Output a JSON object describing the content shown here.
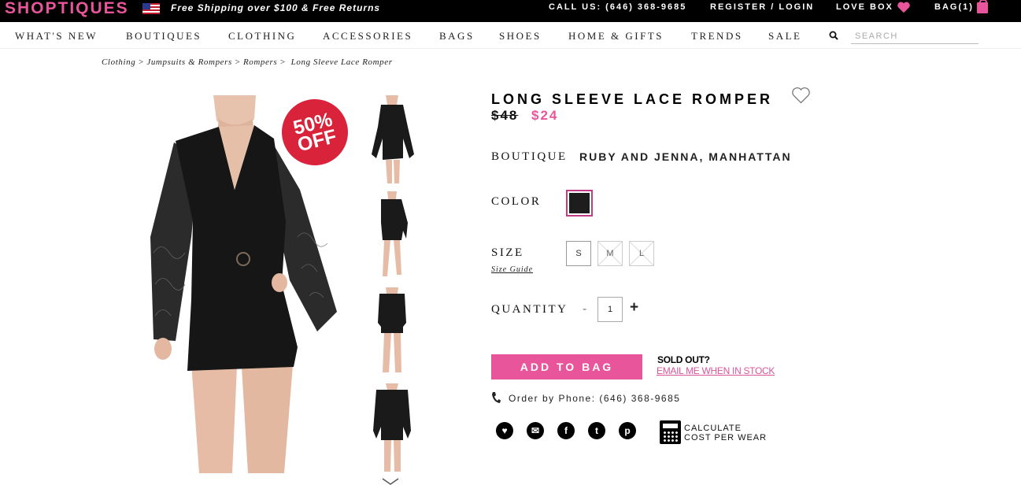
{
  "header": {
    "logo": "SHOPTIQUES",
    "promo": "Free Shipping over $100 & Free Returns",
    "call_us": "CALL US: (646) 368-9685",
    "register_login": "REGISTER / LOGIN",
    "love_box": "LOVE BOX",
    "bag": "BAG(1)",
    "brand_color": "#e9559a"
  },
  "nav": {
    "items": [
      "WHAT'S NEW",
      "BOUTIQUES",
      "CLOTHING",
      "ACCESSORIES",
      "BAGS",
      "SHOES",
      "HOME & GIFTS",
      "TRENDS",
      "SALE"
    ],
    "search_placeholder": "SEARCH"
  },
  "breadcrumb": [
    "Clothing",
    "Jumpsuits & Rompers",
    "Rompers",
    "Long Sleeve Lace Romper"
  ],
  "gallery": {
    "badge_line1": "50%",
    "badge_line2": "OFF",
    "thumb_count": 4
  },
  "product": {
    "title": "LONG SLEEVE LACE ROMPER",
    "price_original": "$48",
    "price_sale": "$24",
    "boutique_label": "BOUTIQUE",
    "boutique_name": "RUBY AND JENNA, MANHATTAN",
    "color_label": "COLOR",
    "selected_color": "#1d1d1d",
    "size_label": "SIZE",
    "sizes": [
      {
        "label": "S",
        "available": true
      },
      {
        "label": "M",
        "available": false
      },
      {
        "label": "L",
        "available": false
      }
    ],
    "size_guide": "Size Guide",
    "quantity_label": "QUANTITY",
    "quantity_minus": "-",
    "quantity": "1",
    "quantity_plus": "+",
    "add_to_bag": "ADD TO BAG",
    "sold_out": "SOLD OUT?",
    "email_me": "EMAIL ME WHEN IN STOCK",
    "order_by_phone": "Order by Phone: (646) 368-9685",
    "calc_line1": "CALCULATE",
    "calc_line2": "COST PER WEAR"
  },
  "share": {
    "icons": [
      "heart-icon",
      "mail-icon",
      "facebook-icon",
      "twitter-icon",
      "pinterest-icon"
    ],
    "glyphs": [
      "♥",
      "✉",
      "f",
      "t",
      "p"
    ]
  }
}
